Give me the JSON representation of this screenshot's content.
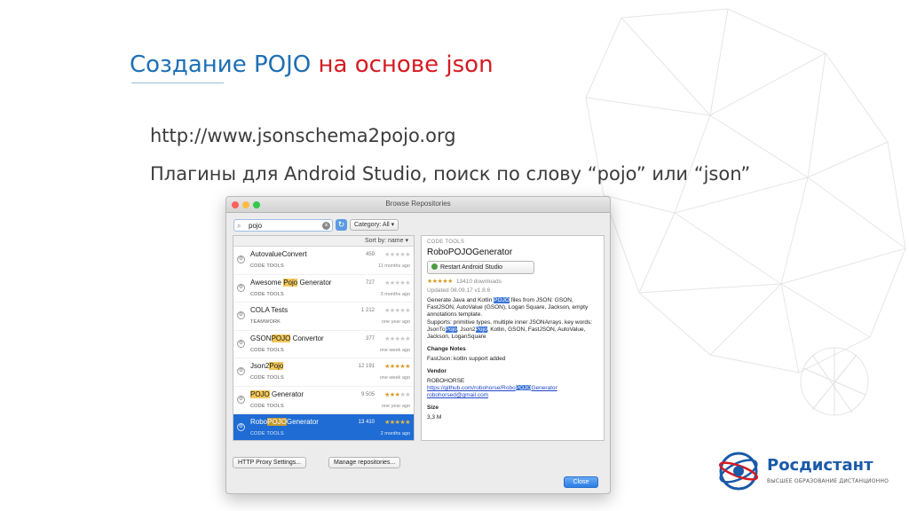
{
  "slide": {
    "title_part1": "Создание POJO",
    "title_part2": "на основе json",
    "url_line": "http://www.jsonschema2pojo.org",
    "plugins_line": "Плагины для Android Studio, поиск по слову “pojo” или “json”"
  },
  "window": {
    "title": "Browse Repositories",
    "search": {
      "value": "pojo"
    },
    "category_label": "Category: All",
    "sort_label": "Sort by: name",
    "plugins": [
      {
        "name_pre": "AutovalueConvert",
        "name_hl": "",
        "name_post": "",
        "category": "CODE TOOLS",
        "downloads": "459",
        "stars_on": "",
        "stars_off": "★★★★★",
        "date": "11 months ago",
        "selected": false
      },
      {
        "name_pre": "Awesome ",
        "name_hl": "Pojo",
        "name_post": " Generator",
        "category": "CODE TOOLS",
        "downloads": "727",
        "stars_on": "",
        "stars_off": "★★★★★",
        "date": "3 months ago",
        "selected": false
      },
      {
        "name_pre": "COLA Tests",
        "name_hl": "",
        "name_post": "",
        "category": "TEAMWORK",
        "downloads": "1 212",
        "stars_on": "",
        "stars_off": "★★★★★",
        "date": "one year ago",
        "selected": false
      },
      {
        "name_pre": "GSON",
        "name_hl": "POJO",
        "name_post": " Convertor",
        "category": "CODE TOOLS",
        "downloads": "377",
        "stars_on": "",
        "stars_off": "★★★★★",
        "date": "one week ago",
        "selected": false
      },
      {
        "name_pre": "Json2",
        "name_hl": "Pojo",
        "name_post": "",
        "category": "CODE TOOLS",
        "downloads": "12 191",
        "stars_on": "★★★★★",
        "stars_off": "",
        "date": "one week ago",
        "selected": false
      },
      {
        "name_pre": "",
        "name_hl": "POJO",
        "name_post": " Generator",
        "category": "CODE TOOLS",
        "downloads": "9 505",
        "stars_on": "★★★",
        "stars_off": "★★",
        "date": "one year ago",
        "selected": false
      },
      {
        "name_pre": "Robo",
        "name_hl": "POJO",
        "name_post": "Generator",
        "category": "CODE TOOLS",
        "downloads": "13 410",
        "stars_on": "★★★★★",
        "stars_off": "",
        "date": "2 months ago",
        "selected": true
      }
    ],
    "detail": {
      "category": "CODE TOOLS",
      "name": "RoboPOJOGenerator",
      "restart_label": "Restart Android Studio",
      "rating_stars": "★★★★★",
      "downloads": "13410 downloads",
      "updated": "Updated 08.09.17   v1.8.6",
      "desc_1": "Generate Java and Kotlin ",
      "desc_hl": "POJO",
      "desc_2": " files from JSON: GSON, FastJSON, AutoValue (GSON), Logan Square, Jackson, empty annotations template.",
      "desc_3": "Supports: primitive types, multiple inner JSONArrays. key words: JsonTo",
      "desc_hl2": "Pojo",
      "desc_4": ", Json2",
      "desc_hl3": "Pojo",
      "desc_5": ", Kotlin, GSON, FastJSON, AutoValue, Jackson, LoganSquare",
      "change_notes_head": "Change Notes",
      "change_notes": "FastJson: kotlin support added",
      "vendor_head": "Vendor",
      "vendor_name": "ROBOHORSE",
      "vendor_link_pre": "https://github.com/robohorse/Robo",
      "vendor_link_hl": "POJO",
      "vendor_link_post": "Generator",
      "vendor_email": "robohorsed@gmail.com",
      "size_head": "Size",
      "size": "3,3 M"
    },
    "proxy_button": "HTTP Proxy Settings...",
    "manage_button": "Manage repositories...",
    "close_button": "Close"
  },
  "logo": {
    "name": "Росдистант",
    "tagline": "ВЫСШЕЕ ОБРАЗОВАНИЕ ДИСТАНЦИОННО",
    "colors": {
      "blue": "#1a5aa8",
      "red": "#d71a21"
    }
  }
}
